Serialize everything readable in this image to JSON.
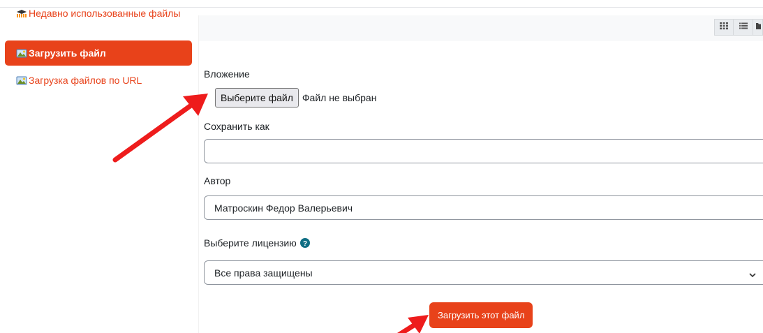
{
  "sidebar": {
    "items": [
      {
        "label": "Недавно использованные файлы",
        "icon": "moodle-recent-icon"
      },
      {
        "label": "Загрузить файл",
        "icon": "upload-image-icon",
        "active": true
      },
      {
        "label": "Загрузка файлов по URL",
        "icon": "url-image-icon"
      }
    ]
  },
  "toolbar": {
    "views": [
      "grid-view-icon",
      "list-view-icon",
      "folder-view-icon"
    ]
  },
  "form": {
    "attachment_label": "Вложение",
    "choose_file_button": "Выберите файл",
    "file_status": "Файл не выбран",
    "save_as_label": "Сохранить как",
    "save_as_value": "",
    "author_label": "Автор",
    "author_value": "Матроскин Федор Валерьевич",
    "license_label": "Выберите лицензию",
    "license_value": "Все права защищены",
    "submit_label": "Загрузить этот файл"
  },
  "colors": {
    "accent": "#e8421a",
    "annotation_arrow": "#ee1c1c",
    "help_icon": "#0f6e84"
  }
}
